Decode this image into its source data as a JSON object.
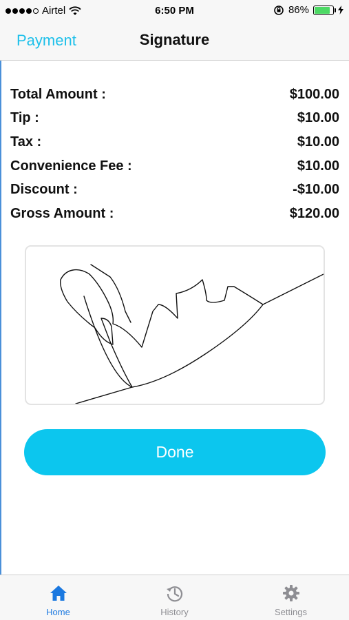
{
  "status_bar": {
    "carrier": "Airtel",
    "time": "6:50 PM",
    "battery_percent": "86%",
    "battery_level": 0.86,
    "signal_bars_filled": 4
  },
  "nav": {
    "back_label": "Payment",
    "title": "Signature"
  },
  "summary": {
    "rows": [
      {
        "label": "Total Amount :",
        "value": "$100.00"
      },
      {
        "label": "Tip :",
        "value": "$10.00"
      },
      {
        "label": "Tax :",
        "value": "$10.00"
      },
      {
        "label": "Convenience Fee :",
        "value": "$10.00"
      },
      {
        "label": "Discount :",
        "value": "-$10.00"
      },
      {
        "label": "Gross Amount :",
        "value": "$120.00"
      }
    ]
  },
  "done_button": {
    "label": "Done"
  },
  "tabs": [
    {
      "label": "Home",
      "icon": "home-icon",
      "active": true
    },
    {
      "label": "History",
      "icon": "history-icon",
      "active": false
    },
    {
      "label": "Settings",
      "icon": "gear-icon",
      "active": false
    }
  ],
  "colors": {
    "accent": "#0cc6ee",
    "nav_back": "#1ec0ea",
    "tab_active": "#1a78e0",
    "tab_inactive": "#8e8e93",
    "battery": "#4cd964"
  }
}
